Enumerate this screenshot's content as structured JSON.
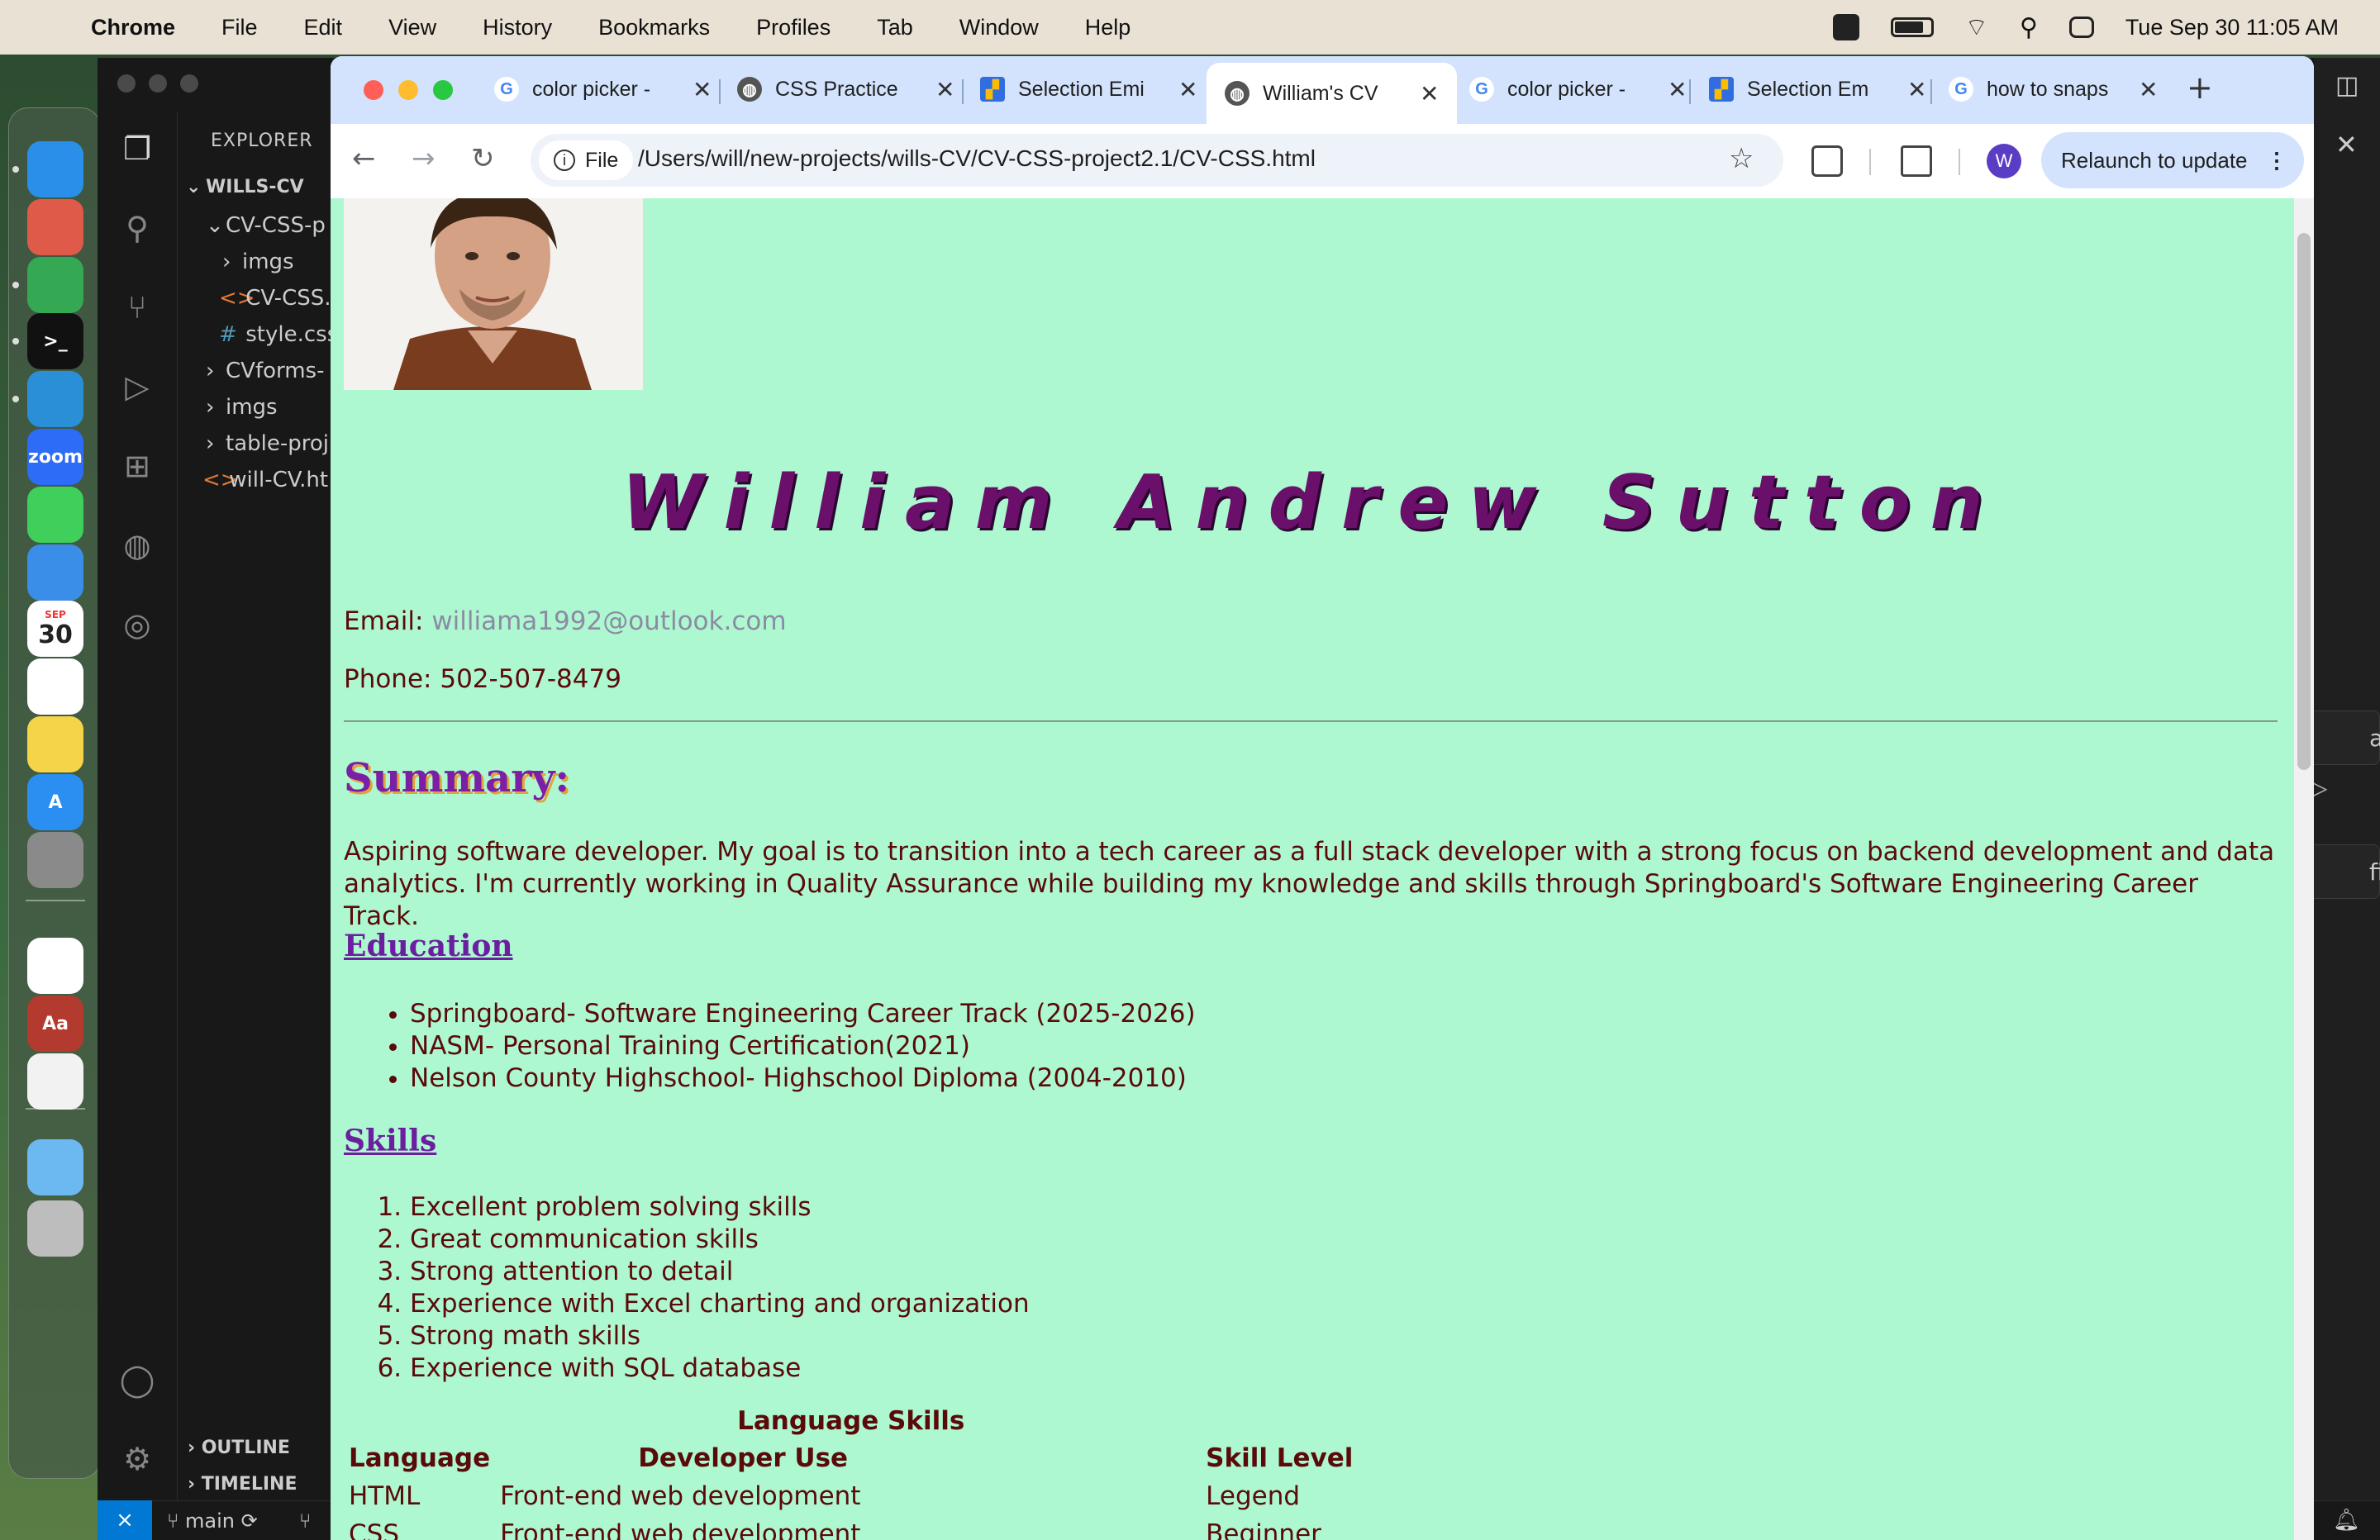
{
  "menubar": {
    "items": [
      "Chrome",
      "File",
      "Edit",
      "View",
      "History",
      "Bookmarks",
      "Profiles",
      "Tab",
      "Window",
      "Help"
    ],
    "datetime": "Tue Sep 30  11:05 AM"
  },
  "dock": {
    "apps": [
      {
        "name": "finder-icon",
        "color": "#2a8fe8",
        "label": ""
      },
      {
        "name": "launchpad-icon",
        "color": "#e05a4a",
        "label": ""
      },
      {
        "name": "chrome-icon",
        "color": "#34a853",
        "label": ""
      },
      {
        "name": "terminal-icon",
        "color": "#111111",
        "label": ">_"
      },
      {
        "name": "vscode-icon",
        "color": "#2b8fd8",
        "label": ""
      },
      {
        "name": "zoom-icon",
        "color": "#2d6cf6",
        "label": "zoom"
      },
      {
        "name": "messages-icon",
        "color": "#3fcf5a",
        "label": ""
      },
      {
        "name": "mail-icon",
        "color": "#3a8ee8",
        "label": ""
      },
      {
        "name": "calendar-icon",
        "color": "#ffffff",
        "label": "30"
      },
      {
        "name": "reminders-icon",
        "color": "#ffffff",
        "label": ""
      },
      {
        "name": "notes-icon",
        "color": "#f6d44a",
        "label": ""
      },
      {
        "name": "app-store-icon",
        "color": "#2a8ff0",
        "label": "A"
      },
      {
        "name": "system-settings-icon",
        "color": "#8a8a8a",
        "label": ""
      },
      {
        "name": "google-drive-icon",
        "color": "#ffffff",
        "label": ""
      },
      {
        "name": "dictionary-icon",
        "color": "#b33a2e",
        "label": "Aa"
      },
      {
        "name": "textedit-icon",
        "color": "#f2f2f2",
        "label": ""
      },
      {
        "name": "folder-icon",
        "color": "#6cb8f0",
        "label": ""
      },
      {
        "name": "trash-icon",
        "color": "#bdbdbd",
        "label": ""
      }
    ],
    "calendar_month": "SEP"
  },
  "vscode": {
    "explorer_title": "EXPLORER",
    "tree": [
      {
        "label": "WILLS-CV",
        "kind": "root"
      },
      {
        "label": "CV-CSS-p",
        "kind": "folder-open"
      },
      {
        "label": "imgs",
        "kind": "folder"
      },
      {
        "label": "CV-CSS.",
        "kind": "html"
      },
      {
        "label": "style.css",
        "kind": "css"
      },
      {
        "label": "CVforms-",
        "kind": "folder"
      },
      {
        "label": "imgs",
        "kind": "folder"
      },
      {
        "label": "table-proj",
        "kind": "folder"
      },
      {
        "label": "will-CV.ht",
        "kind": "html"
      }
    ],
    "outline": "OUTLINE",
    "timeline": "TIMELINE",
    "branch": "main",
    "right_panel": {
      "btn1": "ani",
      "btn2": "fig"
    }
  },
  "chrome": {
    "tabs": [
      {
        "title": "color picker -",
        "favicon": "G",
        "active": false
      },
      {
        "title": "CSS Practice",
        "favicon": "globe",
        "active": false
      },
      {
        "title": "Selection Emi",
        "favicon": "app",
        "active": false
      },
      {
        "title": "William's CV",
        "favicon": "globe",
        "active": true
      },
      {
        "title": "color picker -",
        "favicon": "G",
        "active": false
      },
      {
        "title": "Selection Em",
        "favicon": "app",
        "active": false
      },
      {
        "title": "how to snaps",
        "favicon": "G",
        "active": false
      }
    ],
    "site_chip": "File",
    "url": "/Users/will/new-projects/wills-CV/CV-CSS-project2.1/CV-CSS.html",
    "profile_initial": "W",
    "relaunch_label": "Relaunch to update"
  },
  "cv": {
    "name": "William Andrew Sutton",
    "email_label": "Email:",
    "email": "williama1992@outlook.com",
    "phone_label": "Phone:",
    "phone": "502-507-8479",
    "summary_heading": "Summary:",
    "summary": "Aspiring software developer. My goal is to transition into a tech career as a full stack developer with a strong focus on backend development and data analytics. I'm currently working in Quality Assurance while building my knowledge and skills through Springboard's Software Engineering Career Track.",
    "education_heading": "Education",
    "education": [
      "Springboard- Software Engineering Career Track (2025-2026)",
      "NASM- Personal Training Certification(2021)",
      "Nelson County Highschool- Highschool Diploma (2004-2010)"
    ],
    "skills_heading": "Skills",
    "skills": [
      "Excellent problem solving skills",
      "Great communication skills",
      "Strong attention to detail",
      "Experience with Excel charting and organization",
      "Strong math skills",
      "Experience with SQL database"
    ],
    "lang_table": {
      "caption": "Language Skills",
      "headers": [
        "Language",
        "Developer Use",
        "Skill Level"
      ],
      "rows": [
        [
          "HTML",
          "Front-end web development",
          "Legend"
        ],
        [
          "CSS",
          "Front-end web development",
          "Beginner"
        ]
      ]
    }
  }
}
